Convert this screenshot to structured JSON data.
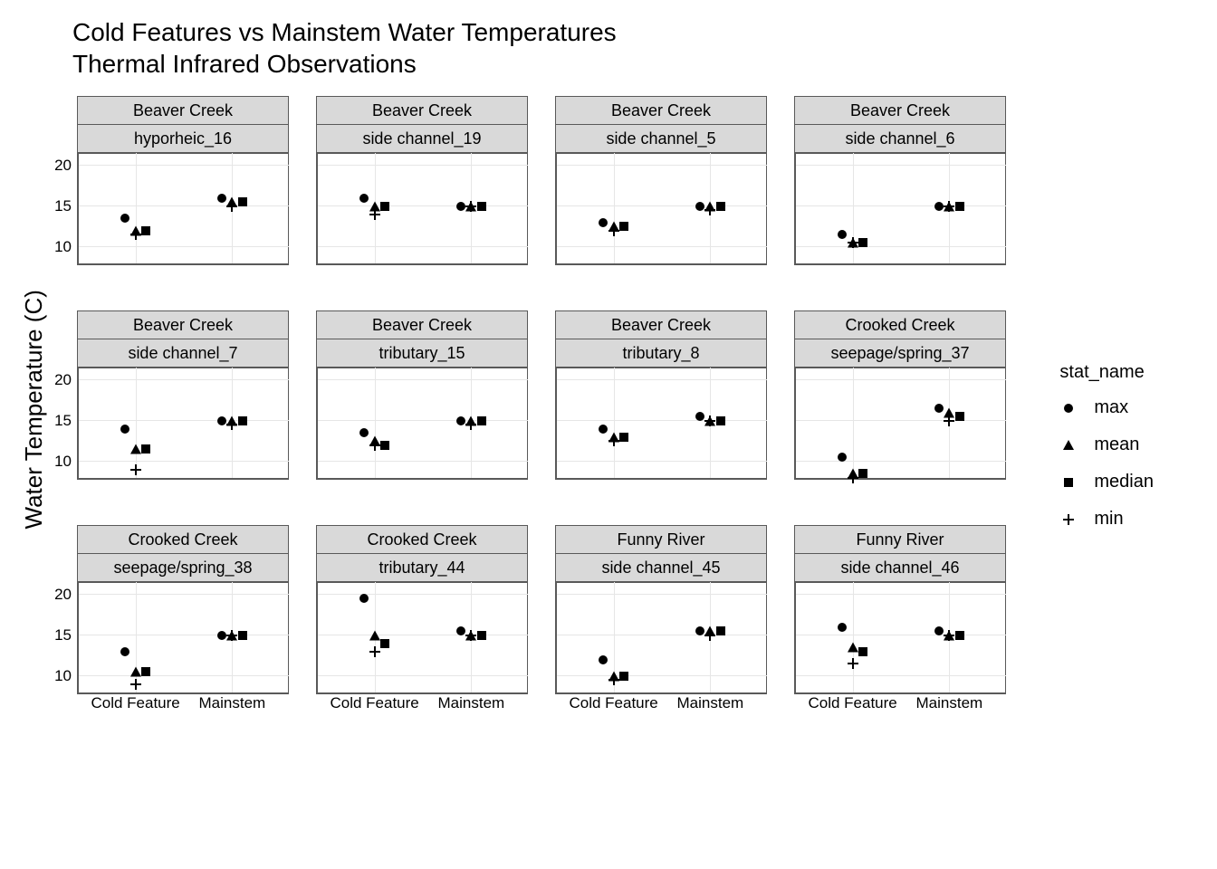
{
  "title_line1": "Cold Features vs Mainstem Water Temperatures",
  "title_line2": " Thermal Infrared Observations",
  "y_axis_label": "Water Temperature (C)",
  "legend": {
    "title": "stat_name",
    "items": [
      {
        "label": "max",
        "shape": "circle"
      },
      {
        "label": "mean",
        "shape": "triangle"
      },
      {
        "label": "median",
        "shape": "square"
      },
      {
        "label": "min",
        "shape": "plus"
      }
    ]
  },
  "chart_data": {
    "type": "scatter",
    "y_ticks": [
      10,
      15,
      20
    ],
    "ylim": [
      8,
      21.5
    ],
    "x_categories": [
      "Cold Feature",
      "Mainstem"
    ],
    "panels": [
      {
        "row": 0,
        "col": 0,
        "strip1": "Beaver Creek",
        "strip2": "hyporheic_16",
        "points": {
          "Cold Feature": {
            "max": 13.5,
            "mean": 12.0,
            "median": 12.0,
            "min": 11.5
          },
          "Mainstem": {
            "max": 16.0,
            "mean": 15.5,
            "median": 15.5,
            "min": 15.0
          }
        }
      },
      {
        "row": 0,
        "col": 1,
        "strip1": "Beaver Creek",
        "strip2": "side channel_19",
        "points": {
          "Cold Feature": {
            "max": 16.0,
            "mean": 15.0,
            "median": 15.0,
            "min": 14.0
          },
          "Mainstem": {
            "max": 15.0,
            "mean": 15.0,
            "median": 15.0,
            "min": 15.0
          }
        }
      },
      {
        "row": 0,
        "col": 2,
        "strip1": "Beaver Creek",
        "strip2": "side channel_5",
        "points": {
          "Cold Feature": {
            "max": 13.0,
            "mean": 12.5,
            "median": 12.5,
            "min": 12.0
          },
          "Mainstem": {
            "max": 15.0,
            "mean": 15.0,
            "median": 15.0,
            "min": 14.5
          }
        }
      },
      {
        "row": 0,
        "col": 3,
        "strip1": "Beaver Creek",
        "strip2": "side channel_6",
        "points": {
          "Cold Feature": {
            "max": 11.5,
            "mean": 10.5,
            "median": 10.5,
            "min": 10.5
          },
          "Mainstem": {
            "max": 15.0,
            "mean": 15.0,
            "median": 15.0,
            "min": 15.0
          }
        }
      },
      {
        "row": 1,
        "col": 0,
        "strip1": "Beaver Creek",
        "strip2": "side channel_7",
        "points": {
          "Cold Feature": {
            "max": 14.0,
            "mean": 11.5,
            "median": 11.5,
            "min": 9.0
          },
          "Mainstem": {
            "max": 15.0,
            "mean": 15.0,
            "median": 15.0,
            "min": 14.5
          }
        }
      },
      {
        "row": 1,
        "col": 1,
        "strip1": "Beaver Creek",
        "strip2": "tributary_15",
        "points": {
          "Cold Feature": {
            "max": 13.5,
            "mean": 12.5,
            "median": 12.0,
            "min": 12.0
          },
          "Mainstem": {
            "max": 15.0,
            "mean": 15.0,
            "median": 15.0,
            "min": 14.5
          }
        }
      },
      {
        "row": 1,
        "col": 2,
        "strip1": "Beaver Creek",
        "strip2": "tributary_8",
        "points": {
          "Cold Feature": {
            "max": 14.0,
            "mean": 13.0,
            "median": 13.0,
            "min": 12.5
          },
          "Mainstem": {
            "max": 15.5,
            "mean": 15.0,
            "median": 15.0,
            "min": 15.0
          }
        }
      },
      {
        "row": 1,
        "col": 3,
        "strip1": "Crooked Creek",
        "strip2": "seepage/spring_37",
        "points": {
          "Cold Feature": {
            "max": 10.5,
            "mean": 8.5,
            "median": 8.5,
            "min": 8.0
          },
          "Mainstem": {
            "max": 16.5,
            "mean": 16.0,
            "median": 15.5,
            "min": 15.0
          }
        }
      },
      {
        "row": 2,
        "col": 0,
        "strip1": "Crooked Creek",
        "strip2": "seepage/spring_38",
        "points": {
          "Cold Feature": {
            "max": 13.0,
            "mean": 10.5,
            "median": 10.5,
            "min": 9.0
          },
          "Mainstem": {
            "max": 15.0,
            "mean": 15.0,
            "median": 15.0,
            "min": 15.0
          }
        }
      },
      {
        "row": 2,
        "col": 1,
        "strip1": "Crooked Creek",
        "strip2": "tributary_44",
        "points": {
          "Cold Feature": {
            "max": 19.5,
            "mean": 15.0,
            "median": 14.0,
            "min": 13.0
          },
          "Mainstem": {
            "max": 15.5,
            "mean": 15.0,
            "median": 15.0,
            "min": 15.0
          }
        }
      },
      {
        "row": 2,
        "col": 2,
        "strip1": "Funny River",
        "strip2": "side channel_45",
        "points": {
          "Cold Feature": {
            "max": 12.0,
            "mean": 10.0,
            "median": 10.0,
            "min": 9.5
          },
          "Mainstem": {
            "max": 15.5,
            "mean": 15.5,
            "median": 15.5,
            "min": 15.0
          }
        }
      },
      {
        "row": 2,
        "col": 3,
        "strip1": "Funny River",
        "strip2": "side channel_46",
        "points": {
          "Cold Feature": {
            "max": 16.0,
            "mean": 13.5,
            "median": 13.0,
            "min": 11.5
          },
          "Mainstem": {
            "max": 15.5,
            "mean": 15.0,
            "median": 15.0,
            "min": 15.0
          }
        }
      }
    ]
  }
}
